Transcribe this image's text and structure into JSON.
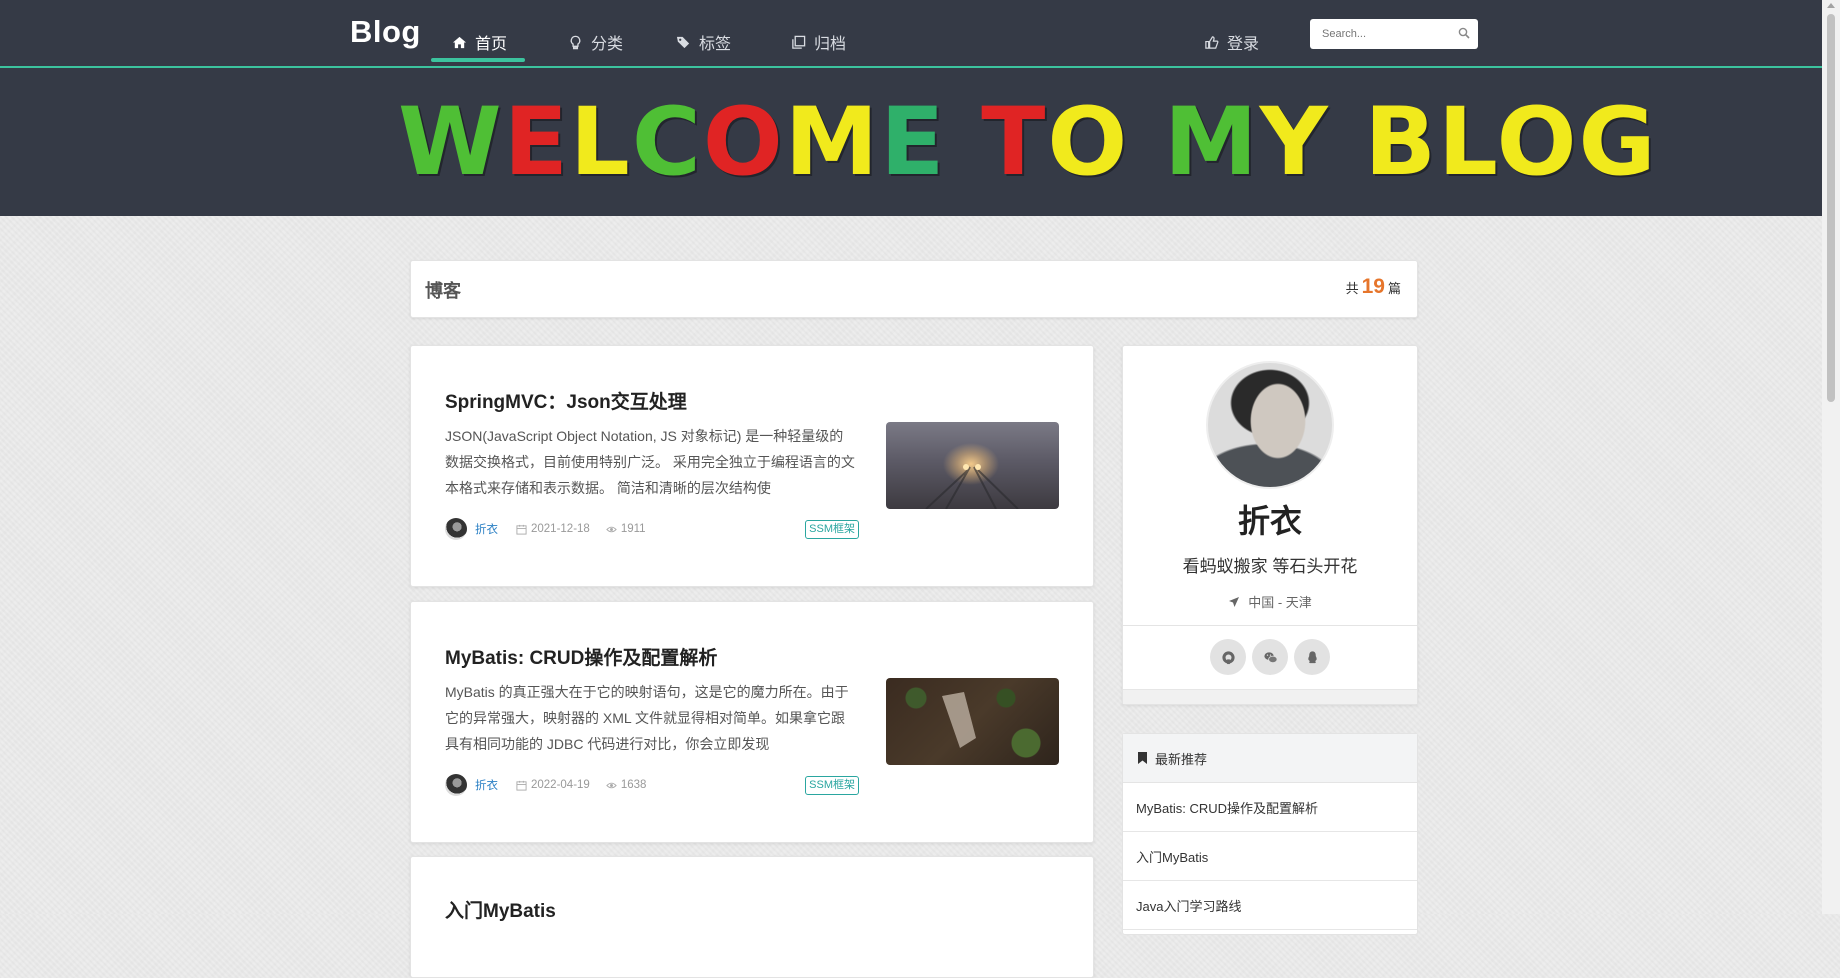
{
  "nav": {
    "brand": "Blog",
    "items": [
      {
        "label": "首页",
        "icon": "home-icon"
      },
      {
        "label": "分类",
        "icon": "lightbulb-icon"
      },
      {
        "label": "标签",
        "icon": "tags-icon"
      },
      {
        "label": "归档",
        "icon": "clone-icon"
      }
    ],
    "login": {
      "label": "登录",
      "icon": "thumbs-up-icon"
    },
    "search": {
      "placeholder": "Search...",
      "icon": "search-icon"
    }
  },
  "hero": {
    "text": "WELCOME TO MY BLOG",
    "colors": {
      "green": "#4fbf35",
      "red": "#e02424",
      "yellow": "#f1ea1c",
      "teal": "#2fb06a"
    }
  },
  "blog_header": {
    "title": "博客",
    "count_prefix": "共",
    "count": "19",
    "count_suffix": "篇"
  },
  "articles": [
    {
      "title": "SpringMVC：Json交互处理",
      "excerpt": "JSON(JavaScript Object Notation, JS 对象标记) 是一种轻量级的数据交换格式，目前使用特别广泛。 采用完全独立于编程语言的文本格式来存储和表示数据。 简洁和清晰的层次结构使",
      "author": "折衣",
      "date": "2021-12-18",
      "views": "1911",
      "tag": "SSM框架"
    },
    {
      "title": "MyBatis: CRUD操作及配置解析",
      "excerpt": "MyBatis 的真正强大在于它的映射语句，这是它的魔力所在。由于它的异常强大，映射器的 XML 文件就显得相对简单。如果拿它跟具有相同功能的 JDBC 代码进行对比，你会立即发现",
      "author": "折衣",
      "date": "2022-04-19",
      "views": "1638",
      "tag": "SSM框架"
    },
    {
      "title": "入门MyBatis"
    }
  ],
  "profile": {
    "name": "折衣",
    "motto": "看蚂蚁搬家 等石头开花",
    "location": "中国 - 天津",
    "social": [
      "github-icon",
      "wechat-icon",
      "qq-icon"
    ]
  },
  "recommend": {
    "title": "最新推荐",
    "items": [
      "MyBatis: CRUD操作及配置解析",
      "入门MyBatis",
      "Java入门学习路线"
    ]
  },
  "colors": {
    "nav_bg": "#353a46",
    "accent": "#3cc39e",
    "count": "#e6752b",
    "author_link": "#2a7fc4",
    "tag": "#2aa6a0"
  }
}
